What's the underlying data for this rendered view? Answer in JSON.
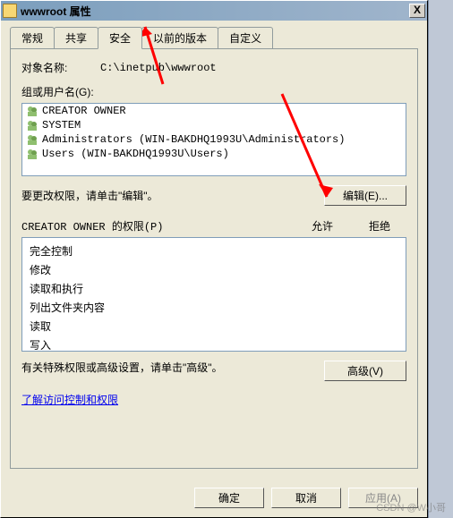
{
  "window": {
    "title": "wwwroot 属性",
    "close": "X"
  },
  "tabs": {
    "t0": "常规",
    "t1": "共享",
    "t2": "安全",
    "t3": "以前的版本",
    "t4": "自定义"
  },
  "obj": {
    "label": "对象名称:",
    "path": "C:\\inetpub\\wwwroot"
  },
  "groups": {
    "label": "组或用户名(G):",
    "items": [
      "CREATOR OWNER",
      "SYSTEM",
      "Administrators (WIN-BAKDHQ1993U\\Administrators)",
      "Users (WIN-BAKDHQ1993U\\Users)"
    ]
  },
  "edit": {
    "hint": "要更改权限，请单击\"编辑\"。",
    "button": "编辑(E)..."
  },
  "perm": {
    "label": "CREATOR OWNER 的权限(P)",
    "allow": "允许",
    "deny": "拒绝",
    "rows": [
      "完全控制",
      "修改",
      "读取和执行",
      "列出文件夹内容",
      "读取",
      "写入"
    ]
  },
  "adv": {
    "hint": "有关特殊权限或高级设置，请单击\"高级\"。",
    "button": "高级(V)"
  },
  "link": "了解访问控制和权限",
  "buttons": {
    "ok": "确定",
    "cancel": "取消",
    "apply": "应用(A)"
  },
  "watermark": "CSDN @W小哥"
}
